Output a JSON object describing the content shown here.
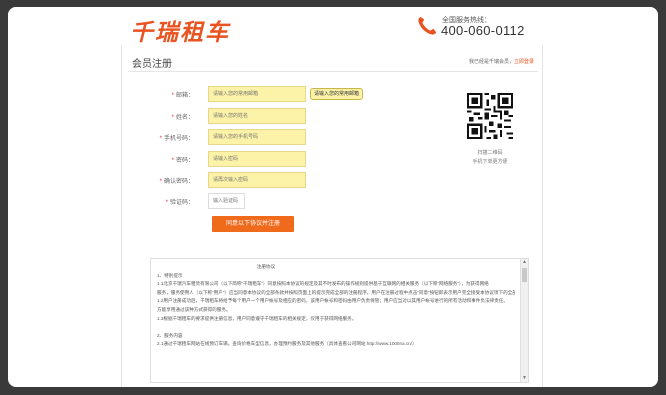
{
  "header": {
    "logo": "千瑞租车",
    "hotline_label": "全国服务热线：",
    "hotline_number": "400-060-0112"
  },
  "card": {
    "title": "会员注册",
    "login_prompt": "我已经是千瑞会员，",
    "login_link": "立即登录"
  },
  "form": {
    "fields": [
      {
        "label": "邮箱：",
        "placeholder": "请输入您的常用邮箱",
        "tip": "请输入您的常用邮箱"
      },
      {
        "label": "姓名：",
        "placeholder": "请输入您的姓名"
      },
      {
        "label": "手机号码：",
        "placeholder": "请输入您的手机号码"
      },
      {
        "label": "密码：",
        "placeholder": "请输入密码"
      },
      {
        "label": "确认密码：",
        "placeholder": "请再次输入密码"
      },
      {
        "label": "验证码：",
        "placeholder": "输入验证码"
      }
    ],
    "submit_label": "同意以下协议并注册"
  },
  "qr": {
    "caption_line1": "扫描二维码",
    "caption_line2": "手机下单更方便"
  },
  "agreement": {
    "title": "注册协议",
    "lines": [
      "1、特别提示",
      "1.1北京千瑞汽车租赁有限公司（以下简称“千瑞租车”）同意按照本协议的规定及其不时发布的操作规则提供基于互联网的相关服务（以下称“网络服务”），为获得网络",
      "服务，服务使用人（以下称“用户”）应当同意本协议的全部条款并按照页面上的提示完成全部的注册程序。用户在注册过程中点击“同意”按钮即表示用户完全接受本协议项下的全部条款。",
      "1.2用户注册成功后，千瑞租车将给予每个用户一个用户帐号及相应的密码，该用户帐号和密码由用户负责保管；用户应当对以其用户帐号进行的所有活动和事件负法律责任。",
      "方能享用通过该种方式获得的服务。",
      "1.3根据千瑞租车的要求提供注册信息，用户同意遵守千瑞租车的相关规定，仅用于获得网络服务。",
      "",
      "2、服务内容",
      "2.1通过千瑞租车网站在线预订车辆，查询价格车型信息，办理预约服务及其他服务（具体查看公司网站 http://www.1000rui.cn/）"
    ]
  }
}
